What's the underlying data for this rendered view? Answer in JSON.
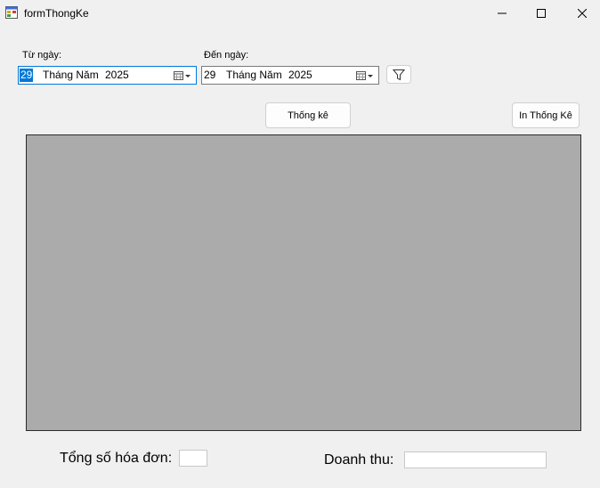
{
  "window": {
    "title": "formThongKe",
    "minimize_icon": "minimize-icon",
    "maximize_icon": "maximize-icon",
    "close_icon": "close-icon"
  },
  "filters": {
    "from_label": "Từ ngày:",
    "to_label": "Đến ngày:",
    "from_date": {
      "day": "29",
      "month": "Tháng Năm",
      "year": "2025"
    },
    "to_date": {
      "day": "29",
      "month": "Tháng Năm",
      "year": "2025"
    },
    "filter_icon": "funnel-icon"
  },
  "toolbar": {
    "stats_button": "Thống kê",
    "print_button": "In Thống Kê"
  },
  "summary": {
    "invoice_count_label": "Tổng số hóa đơn:",
    "invoice_count_value": "",
    "revenue_label": "Doanh thu:",
    "revenue_value": ""
  },
  "colors": {
    "chart_background": "#ababab",
    "accent": "#0078d7"
  }
}
